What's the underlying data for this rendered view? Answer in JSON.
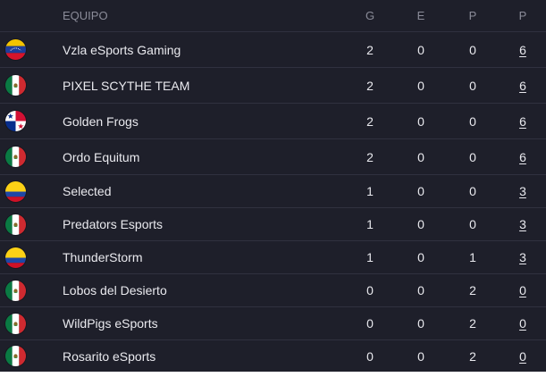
{
  "header": {
    "team": "EQUIPO",
    "g": "G",
    "e": "E",
    "p": "P",
    "pts": "P"
  },
  "rows": [
    {
      "flag": "venezuela-flag",
      "team": "Vzla eSports Gaming",
      "g": "2",
      "e": "0",
      "p": "0",
      "pts": "6"
    },
    {
      "flag": "mexico-flag",
      "team": "PIXEL SCYTHE TEAM",
      "g": "2",
      "e": "0",
      "p": "0",
      "pts": "6"
    },
    {
      "flag": "panama-flag",
      "team": "Golden Frogs",
      "g": "2",
      "e": "0",
      "p": "0",
      "pts": "6"
    },
    {
      "flag": "mexico-flag",
      "team": "Ordo Equitum",
      "g": "2",
      "e": "0",
      "p": "0",
      "pts": "6"
    },
    {
      "flag": "colombia-flag",
      "team": "Selected",
      "g": "1",
      "e": "0",
      "p": "0",
      "pts": "3"
    },
    {
      "flag": "mexico-flag",
      "team": "Predators Esports",
      "g": "1",
      "e": "0",
      "p": "0",
      "pts": "3"
    },
    {
      "flag": "colombia-flag",
      "team": "ThunderStorm",
      "g": "1",
      "e": "0",
      "p": "1",
      "pts": "3"
    },
    {
      "flag": "mexico-flag",
      "team": "Lobos del Desierto",
      "g": "0",
      "e": "0",
      "p": "2",
      "pts": "0"
    },
    {
      "flag": "mexico-flag",
      "team": "WildPigs eSports",
      "g": "0",
      "e": "0",
      "p": "2",
      "pts": "0"
    },
    {
      "flag": "mexico-flag",
      "team": "Rosarito eSports",
      "g": "0",
      "e": "0",
      "p": "2",
      "pts": "0"
    }
  ],
  "colors": {
    "background": "#1e1f2a",
    "text": "#e9e9ee",
    "header_text": "#8b8c99",
    "divider": "#30313f"
  }
}
